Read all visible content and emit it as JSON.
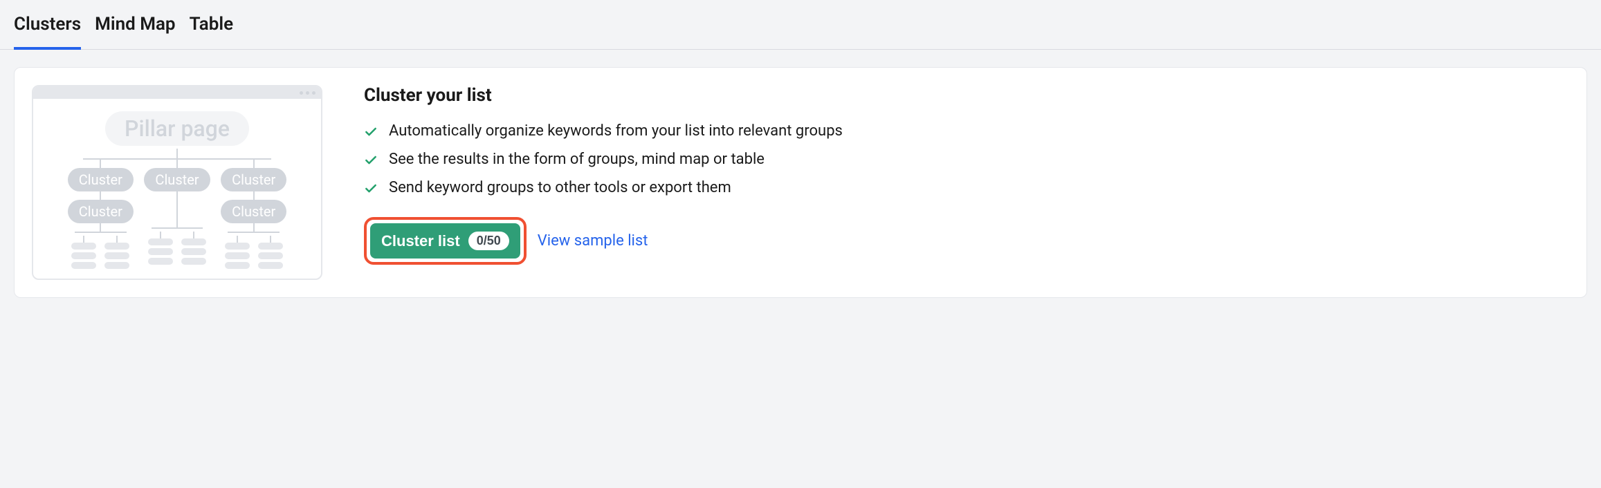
{
  "tabs": [
    {
      "label": "Clusters",
      "active": true
    },
    {
      "label": "Mind Map",
      "active": false
    },
    {
      "label": "Table",
      "active": false
    }
  ],
  "illustration": {
    "pillar_label": "Pillar page",
    "cluster_label": "Cluster"
  },
  "content": {
    "heading": "Cluster your list",
    "features": [
      "Automatically organize keywords from your list into relevant groups",
      "See the results in the form of groups, mind map or table",
      "Send keyword groups to other tools or export them"
    ],
    "cluster_button_label": "Cluster list",
    "cluster_button_badge": "0/50",
    "sample_link_label": "View sample list"
  }
}
